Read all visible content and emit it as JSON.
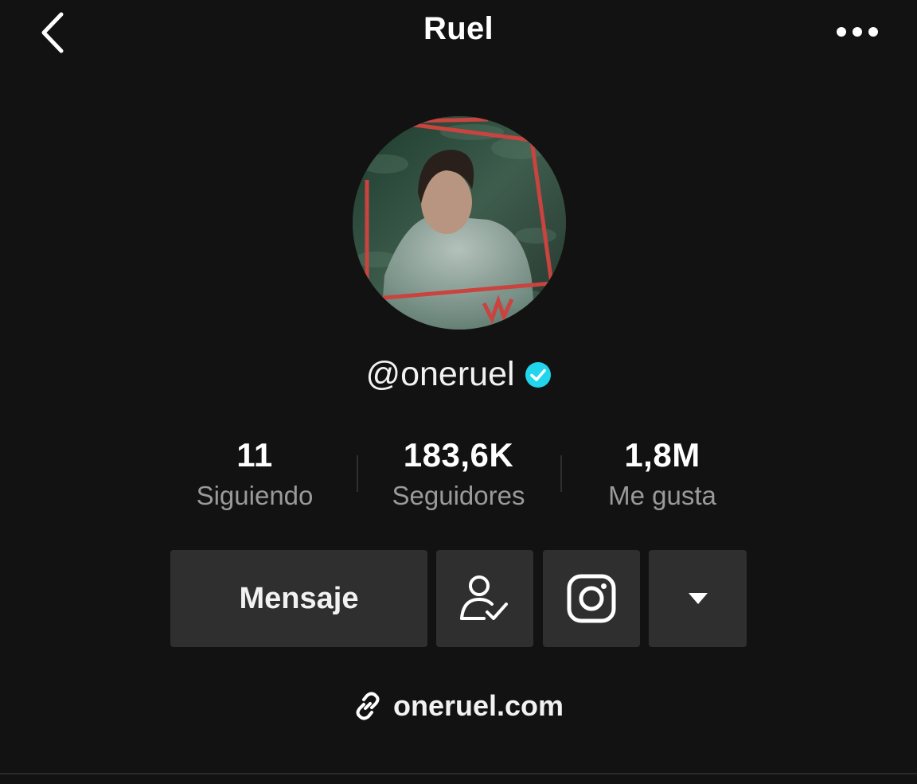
{
  "header": {
    "title": "Ruel",
    "back_icon": "chevron-left-icon",
    "more_icon": "more-horizontal-icon"
  },
  "profile": {
    "handle": "@oneruel",
    "verified": true,
    "verified_color": "#20d5ec",
    "avatar": "profile-photo"
  },
  "stats": [
    {
      "value": "11",
      "label": "Siguiendo"
    },
    {
      "value": "183,6K",
      "label": "Seguidores"
    },
    {
      "value": "1,8M",
      "label": "Me gusta"
    }
  ],
  "actions": {
    "message_label": "Mensaje",
    "follow_icon": "user-check-icon",
    "instagram_icon": "instagram-icon",
    "dropdown_icon": "caret-down-icon"
  },
  "link": {
    "icon": "link-icon",
    "text": "oneruel.com"
  },
  "colors": {
    "background": "#121212",
    "button": "#2f2f2f",
    "secondary_text": "#9a9a9a"
  }
}
